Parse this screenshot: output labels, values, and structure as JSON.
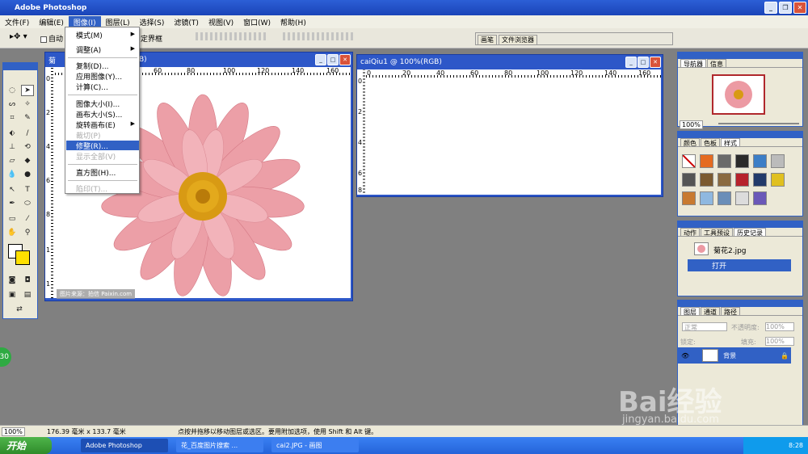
{
  "app": {
    "title": "Adobe Photoshop"
  },
  "menubar": [
    {
      "label": "文件(F)"
    },
    {
      "label": "编辑(E)"
    },
    {
      "label": "图像(I)"
    },
    {
      "label": "图层(L)"
    },
    {
      "label": "选择(S)"
    },
    {
      "label": "滤镜(T)"
    },
    {
      "label": "视图(V)"
    },
    {
      "label": "窗口(W)"
    },
    {
      "label": "帮助(H)"
    }
  ],
  "options": {
    "auto_select": "自动",
    "bounding_box": "定界框",
    "palette_well": [
      "画笔",
      "文件浏览器"
    ]
  },
  "image_menu": {
    "items": [
      "模式(M)",
      "调整(A)",
      "复制(D)...",
      "应用图像(Y)...",
      "计算(C)...",
      "图像大小(I)...",
      "画布大小(S)...",
      "旋转画布(E)",
      "裁切(P)",
      "修整(R)...",
      "显示全部(V)",
      "直方图(H)...",
      "陷印(T)..."
    ],
    "highlighted": "修整(R)..."
  },
  "doc1": {
    "title_visible": "菊",
    "title_suffix": "GB)",
    "credit": "图片来源：拍信 Paixin.com",
    "ruler": [
      "60",
      "80",
      "100",
      "120",
      "140",
      "160"
    ],
    "vruler": [
      "0",
      "2",
      "4",
      "6",
      "8",
      "1",
      "1"
    ]
  },
  "doc2": {
    "title": "caiQiu1 @ 100%(RGB)",
    "ruler": [
      "0",
      "20",
      "40",
      "60",
      "80",
      "100",
      "120",
      "140",
      "160"
    ],
    "vruler": [
      "0",
      "2",
      "4",
      "6",
      "8"
    ]
  },
  "navigator": {
    "tabs": [
      "导航器",
      "信息"
    ],
    "zoom": "100%"
  },
  "color_panel": {
    "tabs": [
      "颜色",
      "色板",
      "样式"
    ]
  },
  "history": {
    "tabs": [
      "动作",
      "工具预设",
      "历史记录"
    ],
    "snapshot": "菊花2.jpg",
    "step": "打开"
  },
  "layers": {
    "tabs": [
      "图层",
      "通道",
      "路径"
    ],
    "blend": "正常",
    "opacity_label": "不透明度:",
    "opacity": "100%",
    "lock_label": "锁定:",
    "fill_label": "填充:",
    "fill": "100%",
    "layer_name": "背景"
  },
  "status": {
    "zoom": "100%",
    "size": "176.39 毫米 x 133.7 毫米",
    "hint": "点按并拖移以移动图层或选区。要用附加选项，使用 Shift 和 Alt 键。"
  },
  "taskbar": {
    "start": "开始",
    "tasks": [
      "Adobe Photoshop",
      "花_百度图片搜索 ...",
      "cai2.JPG - 画图"
    ],
    "clock": "8:28"
  },
  "badge": "30",
  "watermark": {
    "logo": "Bai经验",
    "url": "jingyan.baidu.com"
  }
}
